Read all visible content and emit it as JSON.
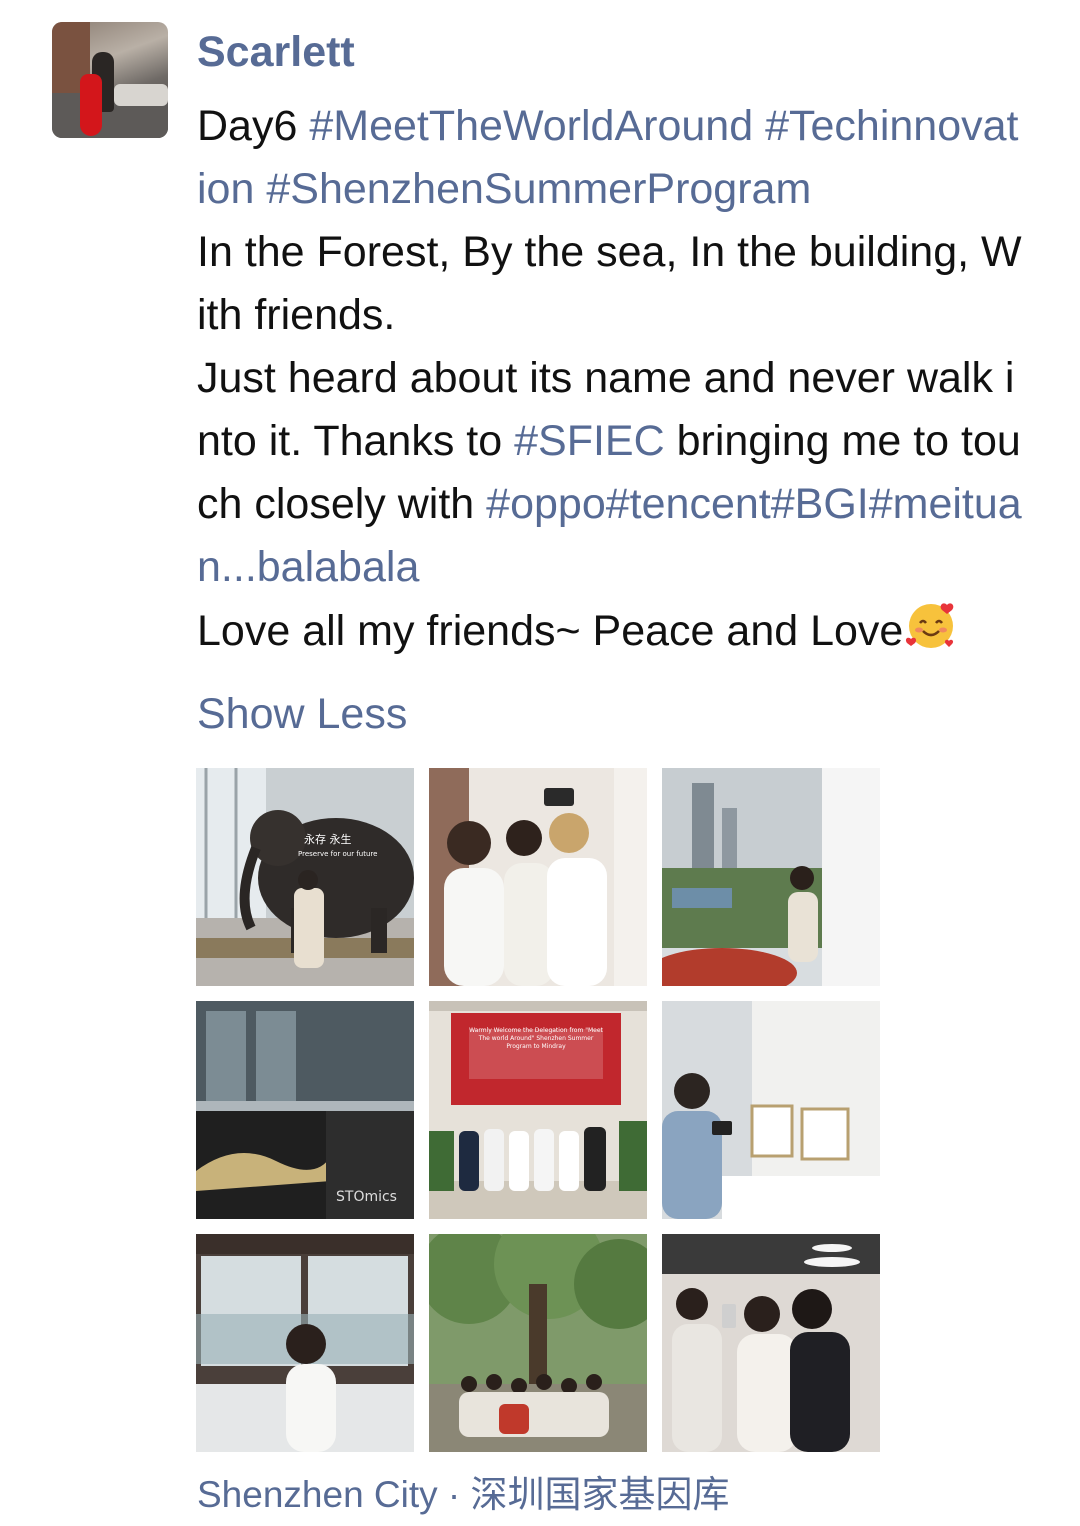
{
  "post": {
    "username": "Scarlett",
    "text_segments": [
      {
        "text": "Day6 ",
        "tag": false
      },
      {
        "text": "#MeetTheWorldAround",
        "tag": true
      },
      {
        "text": " ",
        "tag": false
      },
      {
        "text": "#Techinnovation",
        "tag": true
      },
      {
        "text": " ",
        "tag": false
      },
      {
        "text": "#ShenzhenSummerProgram",
        "tag": true
      },
      {
        "text": "\nIn the Forest, By the sea, In the building, With friends.\nJust heard about its name and never walk into it. Thanks to ",
        "tag": false
      },
      {
        "text": "#SFIEC",
        "tag": true
      },
      {
        "text": " bringing me to touch closely with ",
        "tag": false
      },
      {
        "text": "#oppo",
        "tag": true
      },
      {
        "text": "#tencent",
        "tag": true
      },
      {
        "text": "#BGI",
        "tag": true
      },
      {
        "text": "#meituan",
        "tag": true
      },
      {
        "text": "...balabala",
        "tag": true
      },
      {
        "text": "\nLove all my friends~ Peace and Love",
        "tag": false
      }
    ],
    "emoji_icon": "smiling-face-with-hearts-icon",
    "show_less_label": "Show Less",
    "location": "Shenzhen City · 深圳国家基因库",
    "photos": [
      {
        "name": "mammoth-sculpture-photo",
        "overlay_text": "永存  永生",
        "overlay_sub": "Preserve for our future"
      },
      {
        "name": "selfie-group-photo"
      },
      {
        "name": "city-view-window-photo"
      },
      {
        "name": "seed-exhibit-photo",
        "overlay_text": "STOmics"
      },
      {
        "name": "welcome-screen-group-photo",
        "overlay_text": "Warmly Welcome the Delegation from \"Meet The world Around\" Shenzhen Summer Program to Mindray"
      },
      {
        "name": "gallery-phone-photo"
      },
      {
        "name": "boat-window-photo"
      },
      {
        "name": "forest-group-photo"
      },
      {
        "name": "friends-selfie-photo"
      }
    ]
  },
  "colors": {
    "link": "#576b95",
    "text": "#111111",
    "background": "#ffffff"
  }
}
